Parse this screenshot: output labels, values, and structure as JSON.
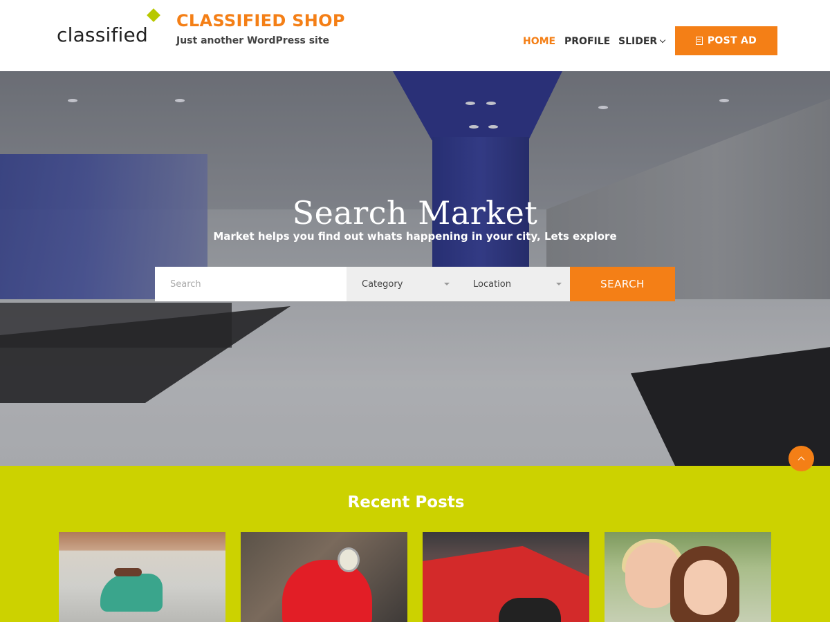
{
  "header": {
    "logo_text": "classified",
    "site_title": "CLASSIFIED SHOP",
    "tagline": "Just another WordPress site",
    "nav": [
      {
        "label": "HOME",
        "active": true
      },
      {
        "label": "PROFILE",
        "active": false
      },
      {
        "label": "SLIDER",
        "active": false
      }
    ],
    "post_ad_label": "POST AD"
  },
  "hero": {
    "title": "Search Market",
    "subtitle": "Market helps you find out whats happening in your city, Lets explore",
    "search_placeholder": "Search",
    "category_label": "Category",
    "location_label": "Location",
    "search_button": "SEARCH"
  },
  "recent": {
    "title": "Recent Posts",
    "posts": [
      {
        "image": "teal scooter"
      },
      {
        "image": "red vespa"
      },
      {
        "image": "red convertible car"
      },
      {
        "image": "dolls"
      }
    ]
  },
  "colors": {
    "accent": "#f47f16",
    "logo_diamond": "#b8c800",
    "recent_bg": "#ccd200"
  },
  "icons": {
    "post_ad": "document-icon",
    "slider_menu": "chevron-down-icon",
    "scroll_top": "chevron-up-icon"
  }
}
